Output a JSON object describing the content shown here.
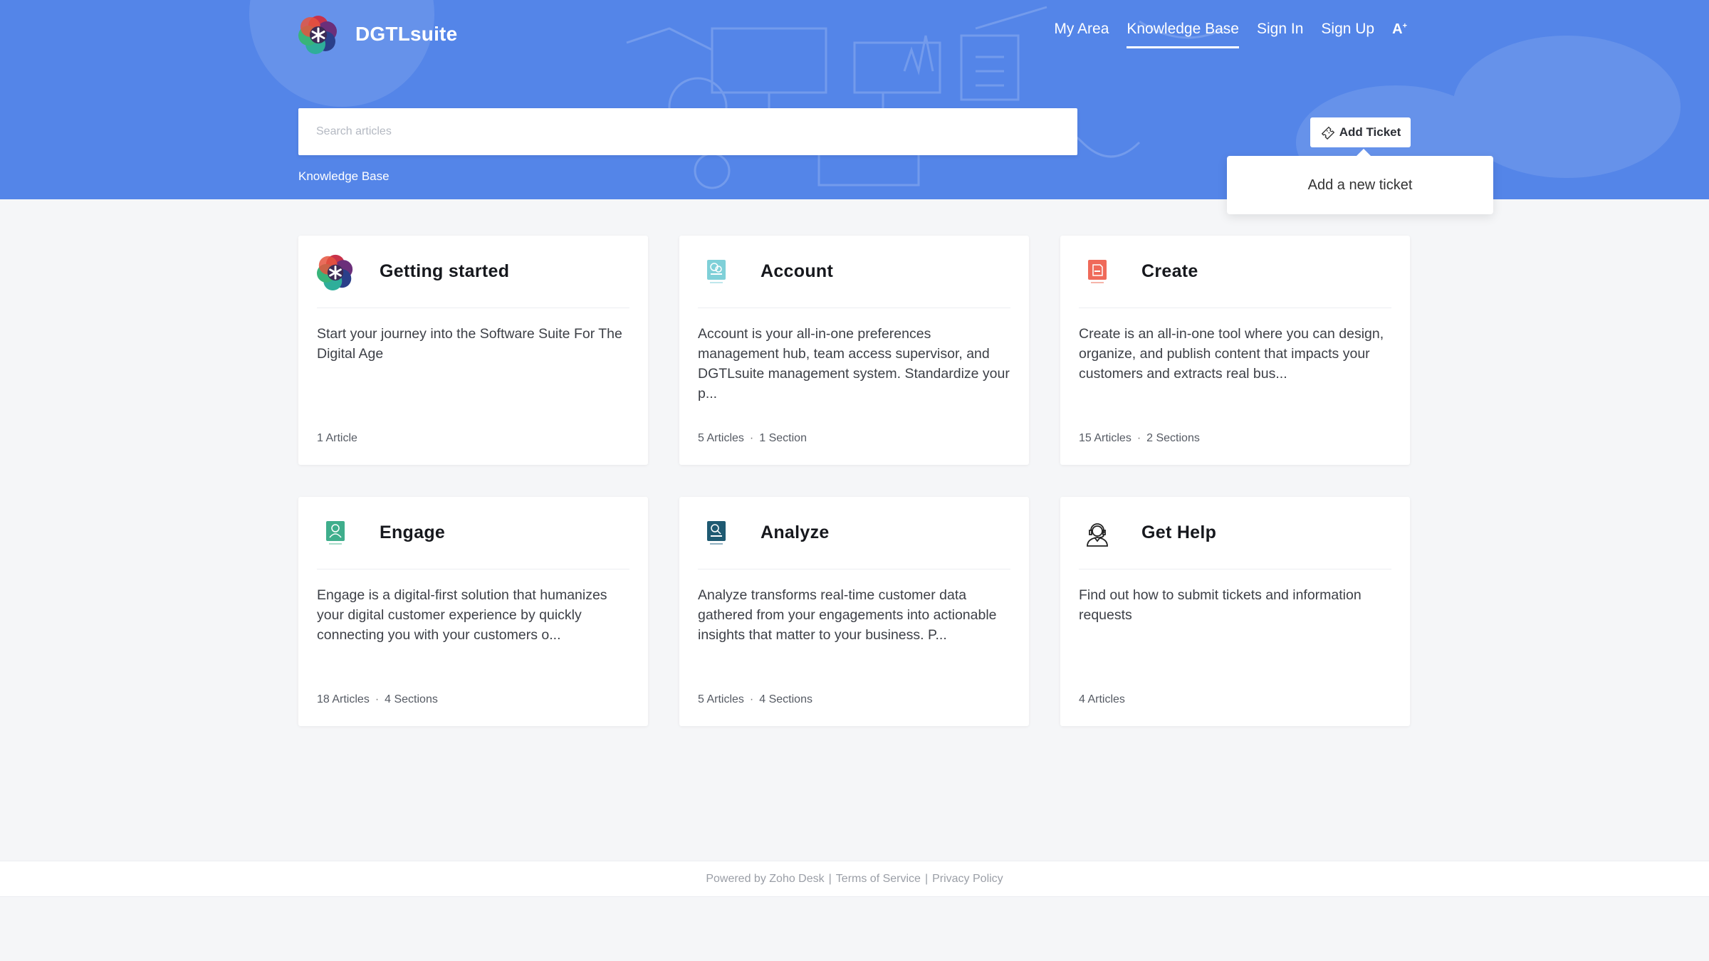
{
  "brand": {
    "name": "DGTLsuite",
    "logo_icon": "dgtlsuite-logo-icon"
  },
  "nav": {
    "items": [
      {
        "label": "My Area",
        "active": false
      },
      {
        "label": "Knowledge Base",
        "active": true
      },
      {
        "label": "Sign In",
        "active": false
      },
      {
        "label": "Sign Up",
        "active": false
      }
    ],
    "font_size_icon": "font-size-icon"
  },
  "search": {
    "placeholder": "Search articles",
    "value": ""
  },
  "breadcrumb": "Knowledge Base",
  "add_ticket": {
    "label": "Add Ticket",
    "icon": "ticket-icon",
    "tooltip": "Add a new ticket"
  },
  "categories": [
    {
      "title": "Getting started",
      "icon": "dgtlsuite-logo-icon",
      "description": "Start your journey into the Software Suite For The Digital Age",
      "articles": "1 Article",
      "sections": ""
    },
    {
      "title": "Account",
      "icon": "account-app-icon",
      "description": "Account is your all-in-one preferences management hub, team access supervisor, and DGTLsuite management system. Standardize your p...",
      "articles": "5 Articles",
      "sections": "1 Section"
    },
    {
      "title": "Create",
      "icon": "create-app-icon",
      "description": "Create is an all-in-one tool where you can design, organize, and publish content that impacts your customers and extracts real bus...",
      "articles": "15 Articles",
      "sections": "2 Sections"
    },
    {
      "title": "Engage",
      "icon": "engage-app-icon",
      "description": "Engage is a digital-first solution that humanizes your digital customer experience by quickly connecting you with your customers o...",
      "articles": "18 Articles",
      "sections": "4 Sections"
    },
    {
      "title": "Analyze",
      "icon": "analyze-app-icon",
      "description": "Analyze transforms real-time customer data gathered from your engagements into actionable insights that matter to your business. P...",
      "articles": "5 Articles",
      "sections": "4 Sections"
    },
    {
      "title": "Get Help",
      "icon": "support-agent-icon",
      "description": "Find out how to submit tickets and information requests",
      "articles": "4 Articles",
      "sections": ""
    }
  ],
  "footer": {
    "powered": "Powered by Zoho Desk",
    "sep": "|",
    "terms": "Terms of Service",
    "privacy": "Privacy Policy"
  },
  "colors": {
    "banner": "#5485e8",
    "page_bg": "#f5f6f8",
    "account_teal": "#7fd0d8",
    "create_red": "#ef6a5a",
    "engage_green": "#3fae8c",
    "analyze_navy": "#1f5a72"
  }
}
